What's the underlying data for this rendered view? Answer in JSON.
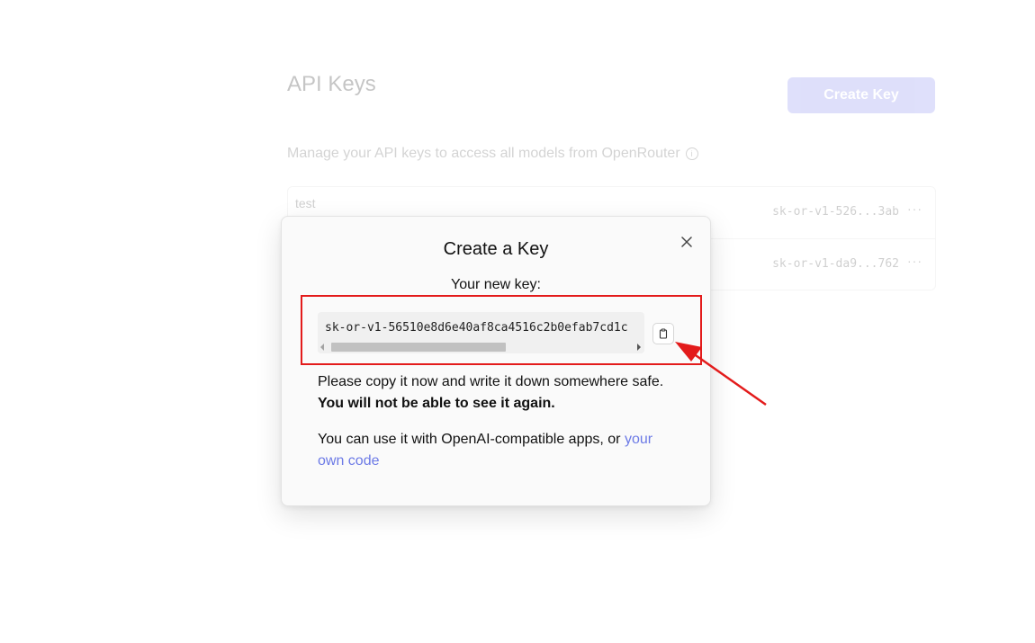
{
  "background": {
    "title": "API Keys",
    "create_button": "Create Key",
    "subtitle": "Manage your API keys to access all models from OpenRouter",
    "info_glyph": "i",
    "keys": [
      {
        "name": "test",
        "key": "sk-or-v1-526...3ab",
        "more": "···"
      },
      {
        "name": "",
        "key": "sk-or-v1-da9...762",
        "more": "···"
      }
    ]
  },
  "modal": {
    "title": "Create a Key",
    "label": "Your new key:",
    "key_value": "sk-or-v1-56510e8d6e40af8ca4516c2b0efab7cd1c",
    "warning_plain": "Please copy it now and write it down somewhere safe. ",
    "warning_bold": "You will not be able to see it again.",
    "use_plain": "You can use it with OpenAI-compatible apps, or ",
    "use_link": "your own code"
  },
  "icons": {
    "close": "close-icon",
    "copy": "clipboard-icon",
    "info": "info-icon"
  },
  "colors": {
    "accent": "#6c7ae6",
    "annotation": "#e31b1b"
  }
}
